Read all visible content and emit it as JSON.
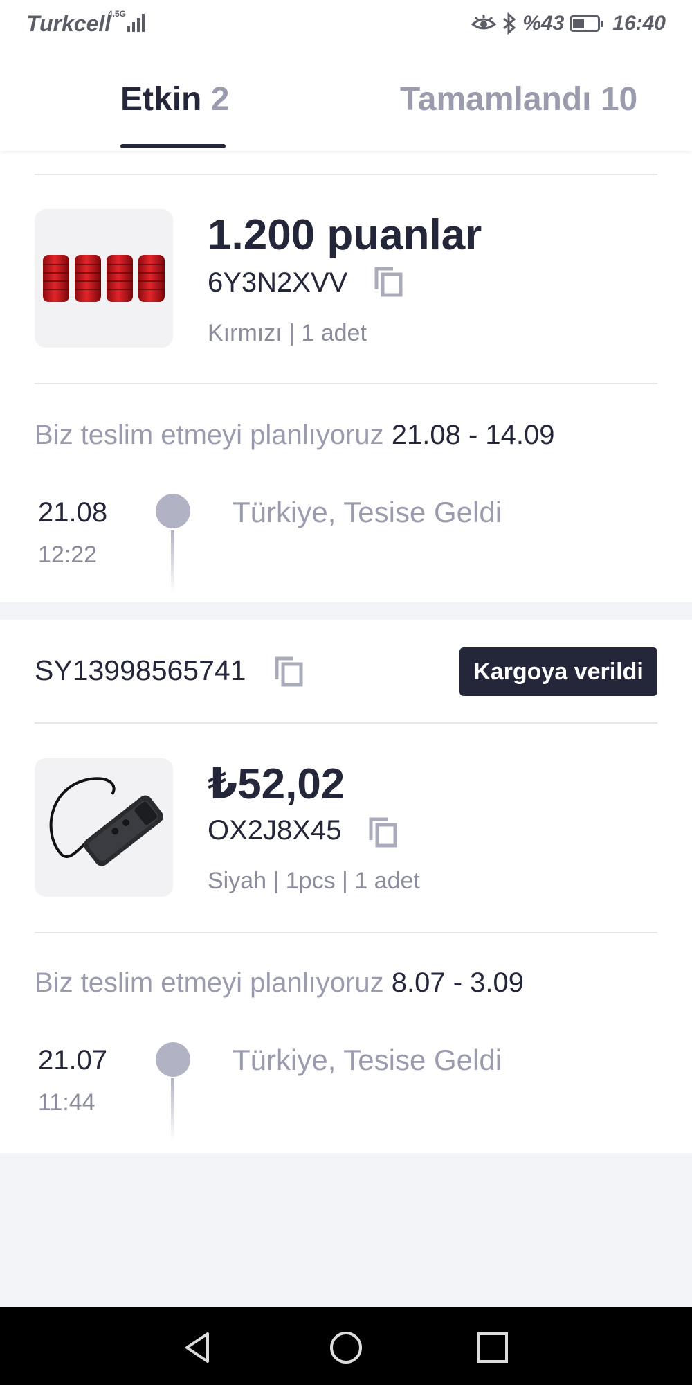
{
  "status_bar": {
    "carrier": "Turkcell",
    "network": "4.5G",
    "battery_percent": "%43",
    "time": "16:40"
  },
  "tabs": [
    {
      "label": "Etkin",
      "count": "2",
      "active": true
    },
    {
      "label": "Tamamlandı",
      "count": "10",
      "active": false
    }
  ],
  "orders": [
    {
      "price": "1.200 puanlar",
      "code": "6Y3N2XVV",
      "variant": "Kırmızı | 1 adet",
      "plan_prefix": "Biz teslim etmeyi planlıyoruz",
      "plan_dates": "21.08 - 14.09",
      "event_date": "21.08",
      "event_time": "12:22",
      "event_text": "Türkiye, Tesise Geldi"
    },
    {
      "tracking": "SY13998565741",
      "status_badge": "Kargoya verildi",
      "price": "₺52,02",
      "code": "OX2J8X45",
      "variant": "Siyah | 1pcs | 1 adet",
      "plan_prefix": "Biz teslim etmeyi planlıyoruz",
      "plan_dates": "8.07 - 3.09",
      "event_date": "21.07",
      "event_time": "11:44",
      "event_text": "Türkiye, Tesise Geldi"
    }
  ],
  "colors": {
    "primary": "#24263a",
    "muted": "#9a9cae",
    "timeline_dot": "#b1b3c4",
    "page_bg": "#f3f4f8",
    "product_red": "#c8141a"
  },
  "icons": [
    "copy-icon",
    "back-icon",
    "home-icon",
    "recents-icon",
    "eye-icon",
    "bluetooth-icon",
    "battery-icon",
    "signal-icon"
  ]
}
